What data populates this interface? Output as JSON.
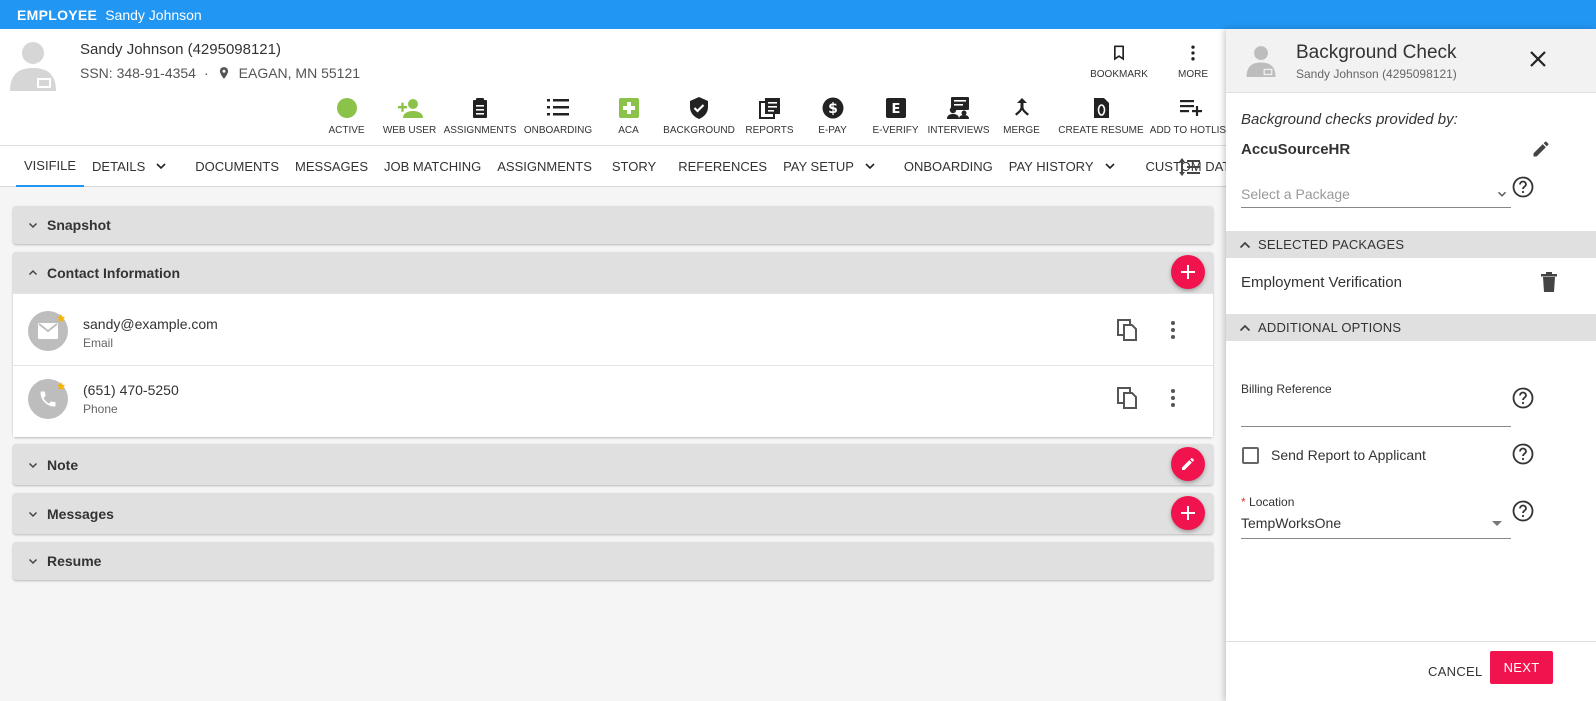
{
  "topbar": {
    "tag": "EMPLOYEE",
    "name": "Sandy Johnson"
  },
  "employee": {
    "name_line": "Sandy Johnson (4295098121)",
    "ssn": "SSN: 348-91-4354",
    "separator": "·",
    "location": "EAGAN, MN 55121"
  },
  "header_actions": {
    "bookmark": "BOOKMARK",
    "more": "MORE"
  },
  "toolbar": [
    {
      "label": "ACTIVE",
      "icon": "active-status-icon"
    },
    {
      "label": "WEB USER",
      "icon": "web-user-icon"
    },
    {
      "label": "ASSIGNMENTS",
      "icon": "clipboard-icon"
    },
    {
      "label": "ONBOARDING",
      "icon": "checklist-icon"
    },
    {
      "label": "ACA",
      "icon": "aca-plus-icon"
    },
    {
      "label": "BACKGROUND",
      "icon": "shield-check-icon"
    },
    {
      "label": "REPORTS",
      "icon": "reports-icon"
    },
    {
      "label": "E-PAY",
      "icon": "dollar-icon"
    },
    {
      "label": "E-VERIFY",
      "icon": "e-verify-icon"
    },
    {
      "label": "INTERVIEWS",
      "icon": "interviews-icon"
    },
    {
      "label": "MERGE",
      "icon": "merge-icon"
    },
    {
      "label": "CREATE RESUME",
      "icon": "resume-icon"
    },
    {
      "label": "ADD TO HOTLIST",
      "icon": "playlist-add-icon"
    }
  ],
  "tabs": [
    {
      "label": "VISIFILE",
      "dropdown": false
    },
    {
      "label": "DETAILS",
      "dropdown": true
    },
    {
      "label": "DOCUMENTS",
      "dropdown": false
    },
    {
      "label": "MESSAGES",
      "dropdown": false
    },
    {
      "label": "JOB MATCHING",
      "dropdown": false
    },
    {
      "label": "ASSIGNMENTS",
      "dropdown": false
    },
    {
      "label": "STORY",
      "dropdown": false
    },
    {
      "label": "REFERENCES",
      "dropdown": false
    },
    {
      "label": "PAY SETUP",
      "dropdown": true
    },
    {
      "label": "ONBOARDING",
      "dropdown": false
    },
    {
      "label": "PAY HISTORY",
      "dropdown": true
    },
    {
      "label": "CUSTOM DATA",
      "dropdown": false
    }
  ],
  "panels": {
    "snapshot": "Snapshot",
    "contact": "Contact Information",
    "note": "Note",
    "messages": "Messages",
    "resume": "Resume"
  },
  "contacts": [
    {
      "value": "sandy@example.com",
      "label": "Email"
    },
    {
      "value": "(651) 470-5250",
      "label": "Phone"
    }
  ],
  "drawer": {
    "title": "Background Check",
    "subtitle": "Sandy Johnson (4295098121)",
    "provided_by": "Background checks provided by:",
    "provider": "AccuSourceHR",
    "package_placeholder": "Select a Package",
    "selected_section": "SELECTED PACKAGES",
    "selected_package": "Employment Verification",
    "options_section": "ADDITIONAL OPTIONS",
    "billing_label": "Billing Reference",
    "billing_value": "",
    "send_report_label": "Send Report to Applicant",
    "send_report_checked": false,
    "location_required": "*",
    "location_label": "Location",
    "location_value": "TempWorksOne",
    "cancel": "CANCEL",
    "next": "NEXT"
  },
  "colors": {
    "primary": "#2196f3",
    "accent": "#f0134d",
    "active_green": "#8bc34a"
  }
}
